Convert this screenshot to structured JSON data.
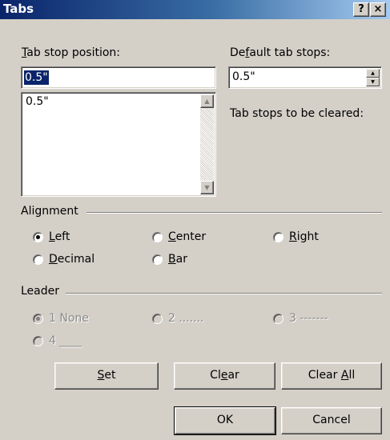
{
  "window": {
    "title": "Tabs",
    "help_button": "?",
    "close_button": "×"
  },
  "tab_stop": {
    "label_access": "T",
    "label_rest": "ab stop position:",
    "value": "0.5\"",
    "list_items": [
      "0.5\""
    ]
  },
  "default_tabs": {
    "label_pre": "De",
    "label_access": "f",
    "label_rest": "ault tab stops:",
    "value": "0.5\""
  },
  "cleared_label": "Tab stops to be cleared:",
  "alignment": {
    "heading": "Alignment",
    "selected": "Left",
    "options": [
      {
        "access": "L",
        "rest": "eft"
      },
      {
        "access": "C",
        "rest": "enter"
      },
      {
        "access": "R",
        "rest": "ight"
      },
      {
        "access": "D",
        "rest": "ecimal"
      },
      {
        "access": "B",
        "rest": "ar"
      }
    ]
  },
  "leader": {
    "heading": "Leader",
    "enabled": false,
    "selected": "1 None",
    "options": [
      "1 None",
      "2 .......",
      "3 -------",
      "4 ____"
    ]
  },
  "buttons": {
    "set_access": "S",
    "set_rest": "et",
    "clear_pre": "Cl",
    "clear_access": "e",
    "clear_rest": "ar",
    "clearall_pre": "Clear ",
    "clearall_access": "A",
    "clearall_rest": "ll",
    "ok": "OK",
    "cancel": "Cancel"
  },
  "colors": {
    "titlebar_start": "#0a246a",
    "titlebar_end": "#a6caf0",
    "dialog_face": "#d4d0c8",
    "selection": "#0a246a"
  }
}
